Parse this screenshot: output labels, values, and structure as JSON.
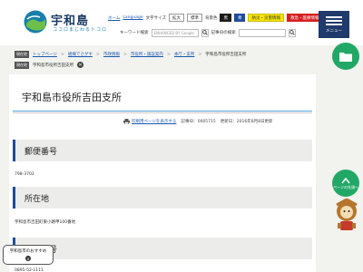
{
  "header": {
    "logo_title": "宇和島",
    "logo_sub": "ココロまじわるトコロ",
    "util_links": [
      "ホーム",
      "Language"
    ],
    "text_size_label": "文字サイズ",
    "text_size_buttons": [
      "拡大",
      "標準"
    ],
    "bg_color_label": "背景色",
    "bg_color_buttons": [
      "黒",
      "青"
    ],
    "disaster_button": "防災・災害情報",
    "emergency_button": "救急・医療情報",
    "keyword_search_label": "キーワード検索",
    "keyword_search_placeholder": "ENHANCED BY Google",
    "article_search_label": "記事IDの検索",
    "menu_label": "メニュー"
  },
  "breadcrumb": {
    "tag": "現在地",
    "items": [
      "トップページ",
      "組織でさがす",
      "市政情報",
      "市役所・施設案内",
      "本庁・支所"
    ],
    "current": "宇和島市役所吉田支所",
    "row2_tag": "現在地",
    "row2_text": "宇和島市役所吉田支所"
  },
  "page": {
    "title": "宇和島市役所吉田支所",
    "print_link": "印刷用ページを表示する",
    "article_id": "記事ID：0005715",
    "updated": "更新日：2016年8月8日更新",
    "sections": [
      {
        "heading": "郵便番号",
        "text": "798-3703"
      },
      {
        "heading": "所在地",
        "text": "宇和島市吉田町東小路甲100番地"
      },
      {
        "heading": "電話番号",
        "text": "0895-52-1111"
      }
    ]
  },
  "side": {
    "top_button_label": "ページの先頭へ",
    "banner_text": "宇和島市のおすすめ"
  },
  "colors": {
    "navy": "#1f3a6b",
    "accent_blue": "#1f4c9b",
    "green": "#22a866",
    "link": "#1a5ab0"
  }
}
